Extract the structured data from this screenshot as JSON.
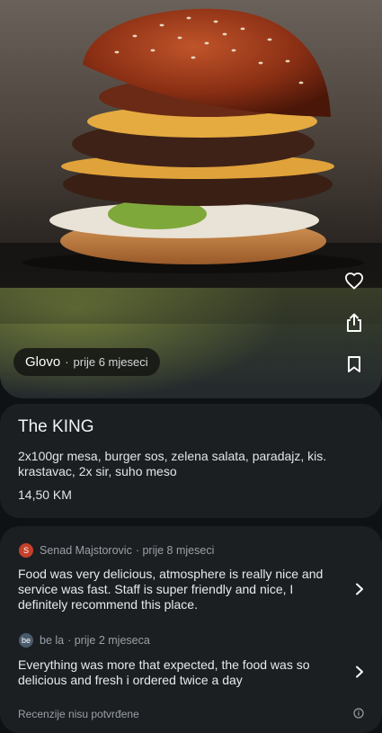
{
  "hero": {
    "source": "Glovo",
    "separator": "·",
    "time": "prije 6 mjeseci"
  },
  "actions": {
    "like_icon": "heart-outline-icon",
    "share_icon": "share-icon",
    "save_icon": "bookmark-outline-icon"
  },
  "item": {
    "title": "The KING",
    "description": "2x100gr mesa, burger sos, zelena salata, paradajz, kis. krastavac, 2x sir, suho meso",
    "price": "14,50 KM"
  },
  "reviews": [
    {
      "avatar_letter": "S",
      "avatar_color": "#c5402b",
      "author": "Senad Majstorovic",
      "time": "· prije 8 mjeseci",
      "text": "Food was very delicious, atmosphere is really nice and service was fast. Staff is super friendly and nice, I definitely recommend this place."
    },
    {
      "avatar_letter": "be",
      "avatar_color": "#4a5a6c",
      "author": "be la",
      "time": "· prije 2 mjeseca",
      "text": "Everything was more that expected, the food was so delicious and fresh i ordered twice a day"
    }
  ],
  "footer": {
    "note": "Recenzije nisu potvrđene"
  }
}
